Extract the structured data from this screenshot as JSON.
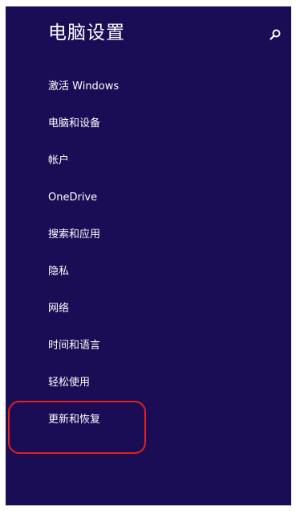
{
  "header": {
    "title": "电脑设置",
    "search_icon": "search-icon"
  },
  "menu": {
    "items": [
      {
        "label": "激活 Windows"
      },
      {
        "label": "电脑和设备"
      },
      {
        "label": "帐户"
      },
      {
        "label": "OneDrive"
      },
      {
        "label": "搜索和应用"
      },
      {
        "label": "隐私"
      },
      {
        "label": "网络"
      },
      {
        "label": "时间和语言"
      },
      {
        "label": "轻松使用"
      },
      {
        "label": "更新和恢复"
      }
    ]
  },
  "colors": {
    "pane_background": "#1a0c55",
    "text": "#ffffff",
    "annotation_highlight": "#e0231c"
  }
}
